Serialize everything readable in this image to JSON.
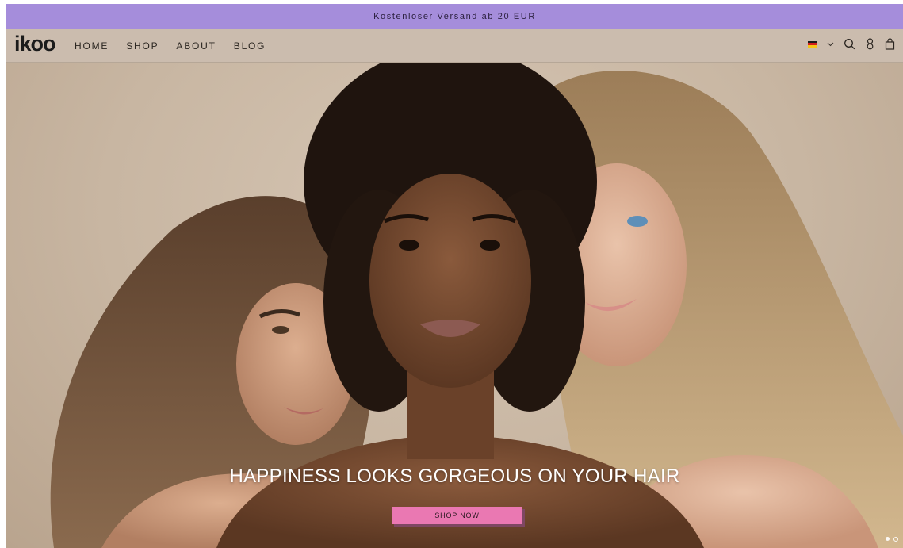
{
  "announcement": {
    "text": "Kostenloser Versand ab 20 EUR",
    "background": "#a58ddb"
  },
  "header": {
    "logo": "ikoo",
    "menu": [
      {
        "label": "HOME"
      },
      {
        "label": "SHOP"
      },
      {
        "label": "ABOUT"
      },
      {
        "label": "BLOG"
      }
    ],
    "icons": [
      "german-flag-icon",
      "chevron-down-icon",
      "search-icon",
      "account-icon",
      "bag-icon"
    ]
  },
  "hero": {
    "headline": "HAPPINESS LOOKS GORGEOUS ON YOUR HAIR",
    "cta_label": "SHOP NOW",
    "cta_color": "#ea78b2",
    "slides_total": 2,
    "active_slide": 1
  }
}
